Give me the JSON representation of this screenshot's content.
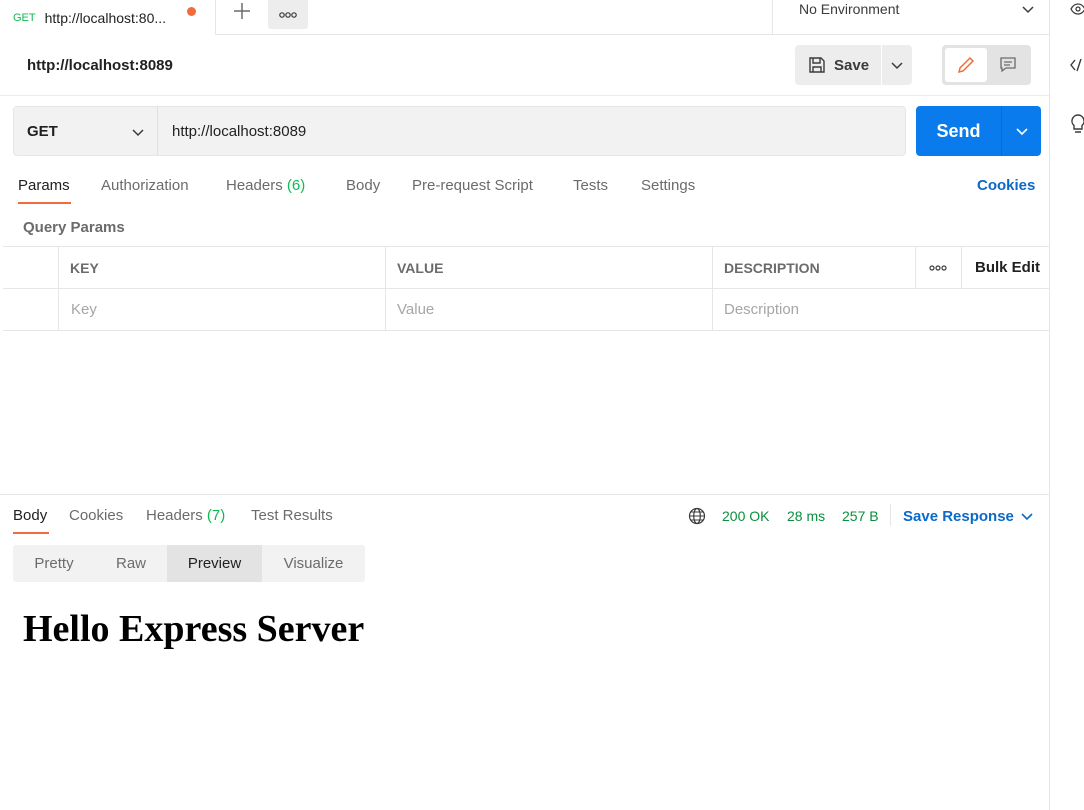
{
  "colors": {
    "accent_orange": "#f26b3a",
    "primary_blue": "#097bed",
    "link_blue": "#0b6ac9",
    "success_green": "#0cbb52"
  },
  "tab_bar": {
    "active_tab": {
      "method": "GET",
      "title": "http://localhost:80...",
      "unsaved_dot": "orange"
    },
    "add_icon": "plus-icon",
    "more_icon": "ellipsis-icon",
    "environment": {
      "selected": "No Environment"
    }
  },
  "right_rail": {
    "icons": [
      "eye-icon",
      "code-icon",
      "lightbulb-icon"
    ]
  },
  "request": {
    "name": "http://localhost:8089",
    "save_label": "Save",
    "method": "GET",
    "url": "http://localhost:8089",
    "send_label": "Send"
  },
  "request_tabs": {
    "params": "Params",
    "authorization": "Authorization",
    "headers": "Headers",
    "headers_count": "(6)",
    "body": "Body",
    "pre_request": "Pre-request Script",
    "tests": "Tests",
    "settings": "Settings",
    "cookies": "Cookies",
    "active": "Params"
  },
  "query_params": {
    "title": "Query Params",
    "columns": {
      "key": "KEY",
      "value": "VALUE",
      "description": "DESCRIPTION",
      "bulk_edit": "Bulk Edit"
    },
    "placeholders": {
      "key": "Key",
      "value": "Value",
      "description": "Description"
    }
  },
  "response": {
    "tabs": {
      "body": "Body",
      "cookies": "Cookies",
      "headers": "Headers",
      "headers_count": "(7)",
      "test_results": "Test Results",
      "active": "Body"
    },
    "status": "200 OK",
    "time": "28 ms",
    "size": "257 B",
    "save_response": "Save Response",
    "view_modes": {
      "pretty": "Pretty",
      "raw": "Raw",
      "preview": "Preview",
      "visualize": "Visualize",
      "active": "Preview"
    },
    "preview_heading": "Hello Express Server"
  }
}
